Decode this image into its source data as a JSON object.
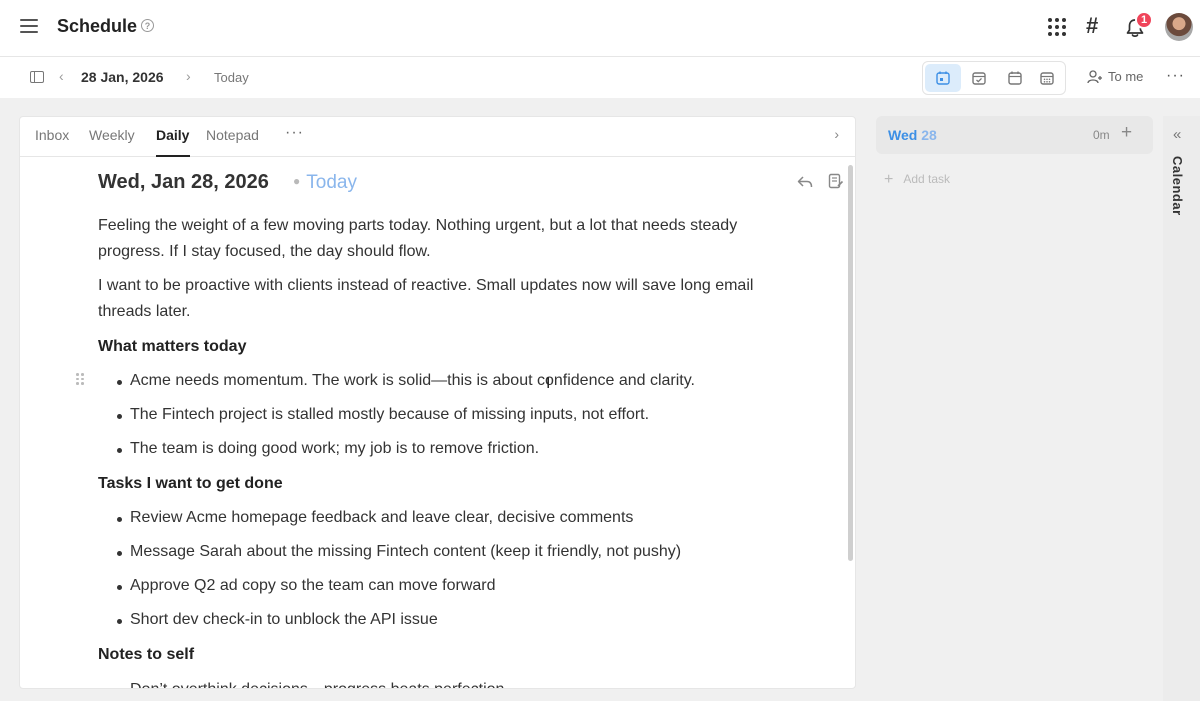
{
  "header": {
    "title": "Schedule",
    "notification_count": "1"
  },
  "toolbar": {
    "date": "28 Jan, 2026",
    "today": "Today",
    "assign_filter": "To me"
  },
  "tabs": [
    {
      "label": "Inbox"
    },
    {
      "label": "Weekly"
    },
    {
      "label": "Daily",
      "active": true
    },
    {
      "label": "Notepad"
    }
  ],
  "document": {
    "title": "Wed, Jan 28, 2026",
    "today_tag": "Today",
    "paragraphs": [
      "Feeling the weight of a few moving parts today. Nothing urgent, but a lot that needs steady progress. If I stay focused, the day should flow.",
      "I want to be proactive with clients instead of reactive. Small updates now will save long email threads later."
    ],
    "sections": [
      {
        "heading": "What matters today",
        "items": [
          "Acme needs momentum. The work is solid—this is about confidence and clarity.",
          "The Fintech project is stalled mostly because of missing inputs, not effort.",
          "The team is doing good work; my job is to remove friction."
        ]
      },
      {
        "heading": "Tasks I want to get done",
        "items": [
          "Review Acme homepage feedback and leave clear, decisive comments",
          "Message Sarah about the missing Fintech content (keep it friendly, not pushy)",
          "Approve Q2 ad copy so the team can move forward",
          "Short dev check-in to unblock the API issue"
        ]
      },
      {
        "heading": "Notes to self",
        "items": [
          "Don’t overthink decisions—progress beats perfection"
        ]
      }
    ]
  },
  "day_column": {
    "day": "Wed",
    "date": "28",
    "duration": "0m",
    "add_task": "Add task"
  },
  "calendar_strip": {
    "label": "Calendar"
  },
  "colors": {
    "accent": "#3c8fe5",
    "today": "#8ab6ec",
    "badge": "#f0445a",
    "active_view": "#dcecfb"
  }
}
